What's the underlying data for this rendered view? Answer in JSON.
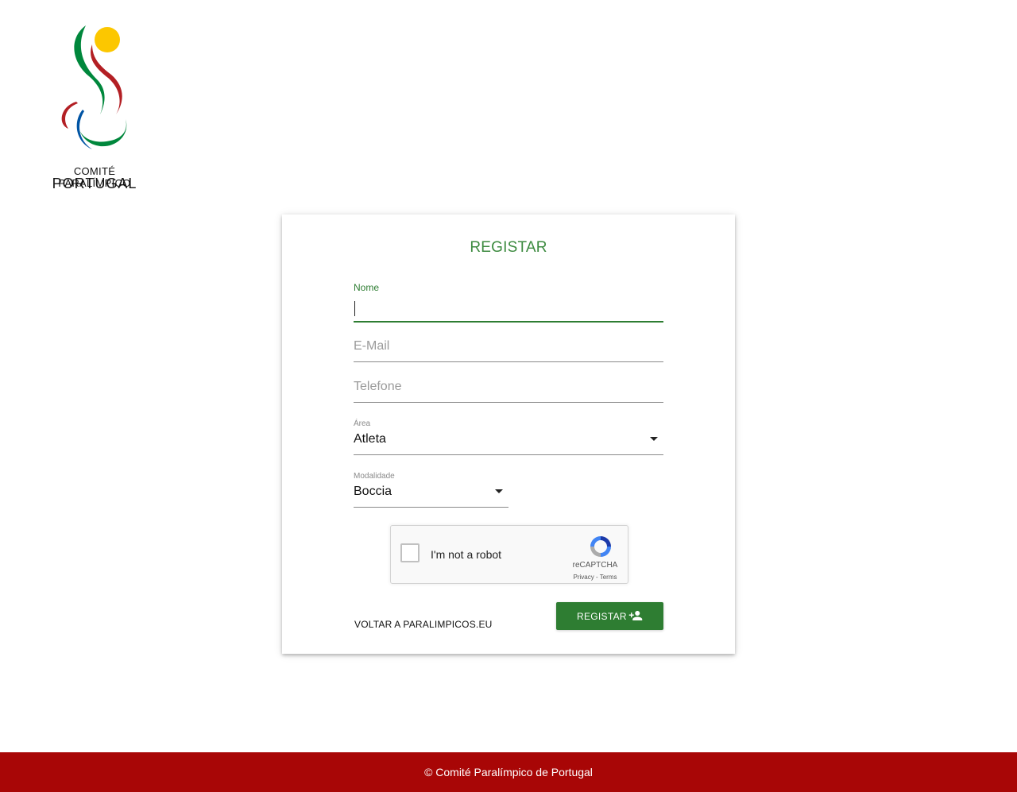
{
  "logo": {
    "line1": "COMITÉ PARALÍMPICO",
    "line2": "PORTUGAL",
    "colors": {
      "yellow": "#fcc700",
      "green": "#00873c",
      "red": "#b31f24",
      "blue": "#0054a4"
    }
  },
  "form": {
    "title": "REGISTAR",
    "nome_label": "Nome",
    "nome_value": "",
    "email_placeholder": "E-Mail",
    "telefone_placeholder": "Telefone",
    "area_label": "Área",
    "area_value": "Atleta",
    "modalidade_label": "Modalidade",
    "modalidade_value": "Boccia",
    "back_link": "VOLTAR A PARALIMPICOS.EU",
    "submit_label": "REGISTAR",
    "accent": "#2e7d32"
  },
  "recaptcha": {
    "text": "I'm not a robot",
    "brand": "reCAPTCHA",
    "links": "Privacy - Terms"
  },
  "footer": {
    "text": "© Comité Paralímpico de Portugal",
    "background": "#a80606"
  }
}
